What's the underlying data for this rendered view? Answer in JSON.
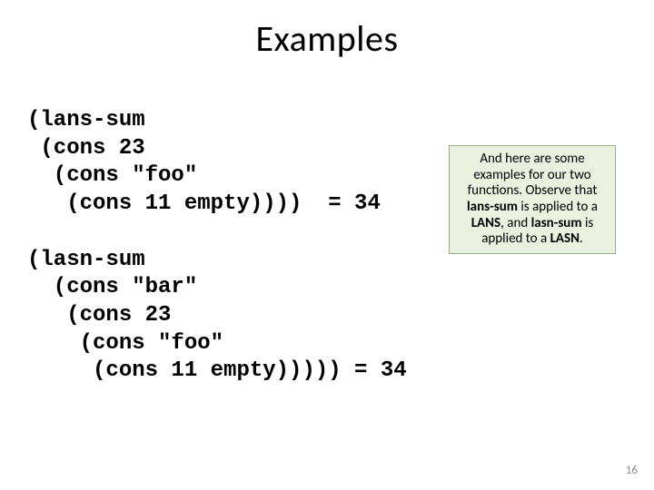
{
  "title": "Examples",
  "code": "(lans-sum\n (cons 23\n  (cons \"foo\"\n   (cons 11 empty))))  = 34\n\n(lasn-sum\n  (cons \"bar\"\n   (cons 23\n    (cons \"foo\"\n     (cons 11 empty))))) = 34",
  "callout": {
    "t1": "And here are some examples for our two functions.  Observe that ",
    "b1": "lans-sum",
    "t2": " is applied to a ",
    "b2": "LANS",
    "t3": ", and ",
    "b3": "lasn-sum",
    "t4": " is applied to a ",
    "b4": "LASN",
    "t5": "."
  },
  "page_number": "16"
}
